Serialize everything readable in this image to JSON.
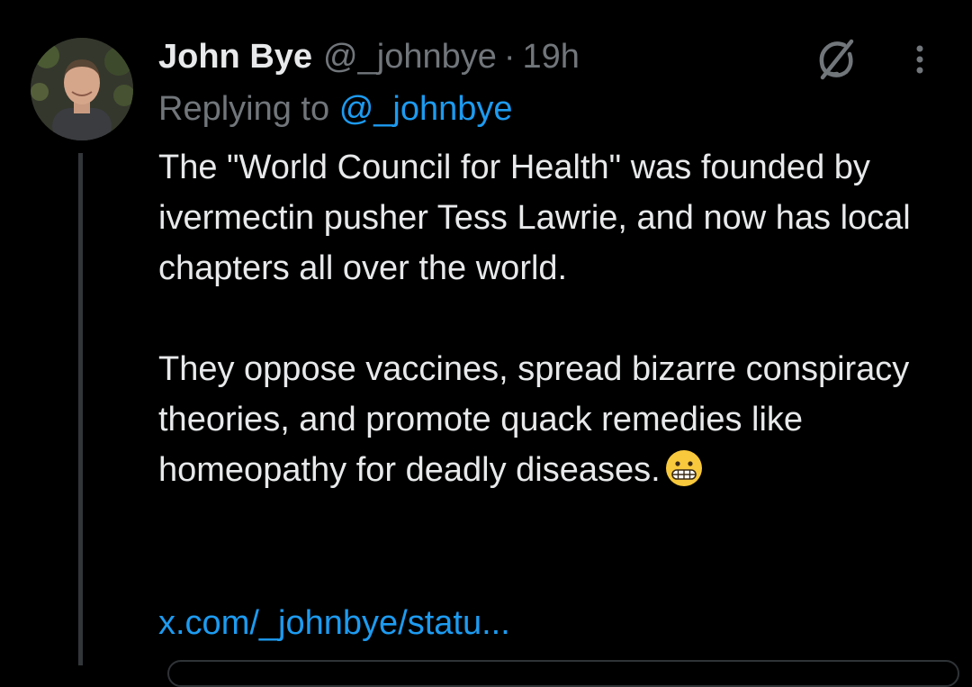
{
  "tweet": {
    "display_name": "John Bye",
    "handle": "@_johnbye",
    "separator": "·",
    "time": "19h",
    "reply_prefix": "Replying to",
    "reply_handle": "@_johnbye",
    "paragraph1": "The \"World Council for Health\" was founded by ivermectin pusher Tess Lawrie, and now has local chapters all over the world.",
    "paragraph2": "They oppose vaccines, spread bizarre conspiracy theories, and promote quack remedies like homeopathy for deadly diseases.",
    "emoji_icon": "grimacing-face-emoji",
    "link": "x.com/_johnbye/statu..."
  },
  "icons": {
    "grok": "grok-icon",
    "more": "more-vertical-icon"
  },
  "colors": {
    "background": "#000000",
    "text_primary": "#e7e9ea",
    "text_secondary": "#71767b",
    "link": "#1d9bf0",
    "thread_line": "#333639"
  }
}
